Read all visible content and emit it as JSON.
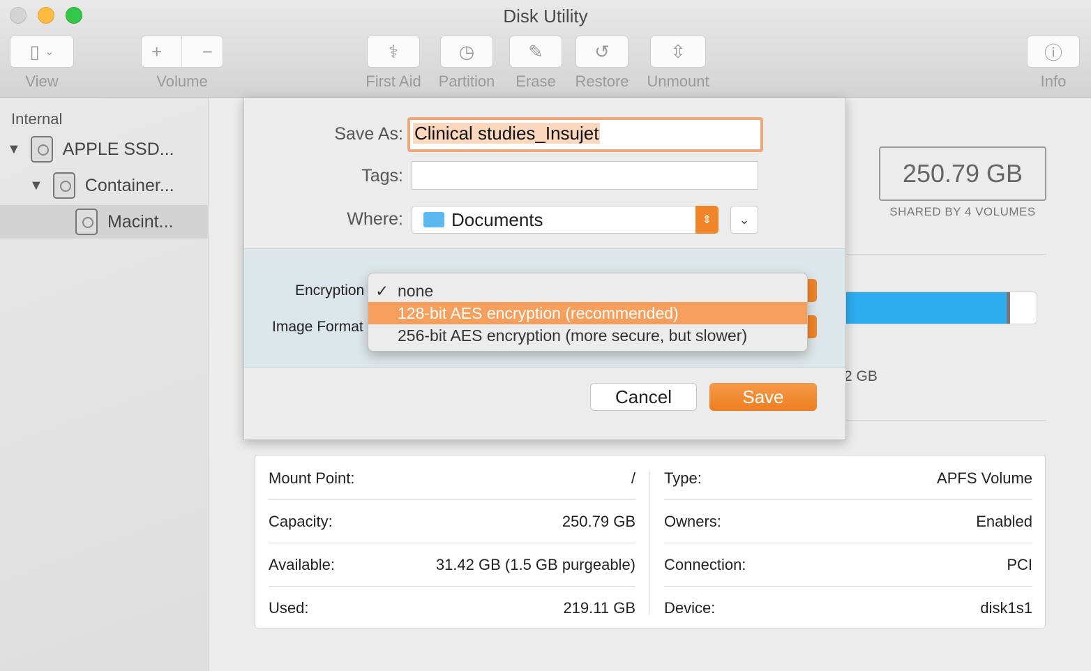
{
  "window": {
    "title": "Disk Utility"
  },
  "toolbar": {
    "view": "View",
    "volume": "Volume",
    "first_aid": "First Aid",
    "partition": "Partition",
    "erase": "Erase",
    "restore": "Restore",
    "unmount": "Unmount",
    "info": "Info"
  },
  "sidebar": {
    "section": "Internal",
    "items": [
      {
        "label": "APPLE SSD..."
      },
      {
        "label": "Container..."
      },
      {
        "label": "Macint..."
      }
    ]
  },
  "volume": {
    "capacity_big": "250.79 GB",
    "shared": "SHARED BY 4 VOLUMES",
    "used_fraction": 0.874,
    "partial_label": "2 GB"
  },
  "sheet": {
    "save_as_label": "Save As:",
    "save_as_value": "Clinical studies_Insujet",
    "tags_label": "Tags:",
    "tags_value": "",
    "where_label": "Where:",
    "where_value": "Documents",
    "encryption_label": "Encryption",
    "image_format_label": "Image Format",
    "cancel": "Cancel",
    "save": "Save"
  },
  "encryption_menu": {
    "items": [
      "none",
      "128-bit AES encryption (recommended)",
      "256-bit AES encryption (more secure, but slower)"
    ],
    "checked": 0,
    "highlighted": 1
  },
  "details": {
    "left": [
      {
        "k": "Mount Point:",
        "v": "/"
      },
      {
        "k": "Capacity:",
        "v": "250.79 GB"
      },
      {
        "k": "Available:",
        "v": "31.42 GB (1.5 GB purgeable)"
      },
      {
        "k": "Used:",
        "v": "219.11 GB"
      }
    ],
    "right": [
      {
        "k": "Type:",
        "v": "APFS Volume"
      },
      {
        "k": "Owners:",
        "v": "Enabled"
      },
      {
        "k": "Connection:",
        "v": "PCI"
      },
      {
        "k": "Device:",
        "v": "disk1s1"
      }
    ]
  },
  "colors": {
    "accent": "#f0852a",
    "highlight": "#f69e5b",
    "bar": "#2eacf0"
  }
}
